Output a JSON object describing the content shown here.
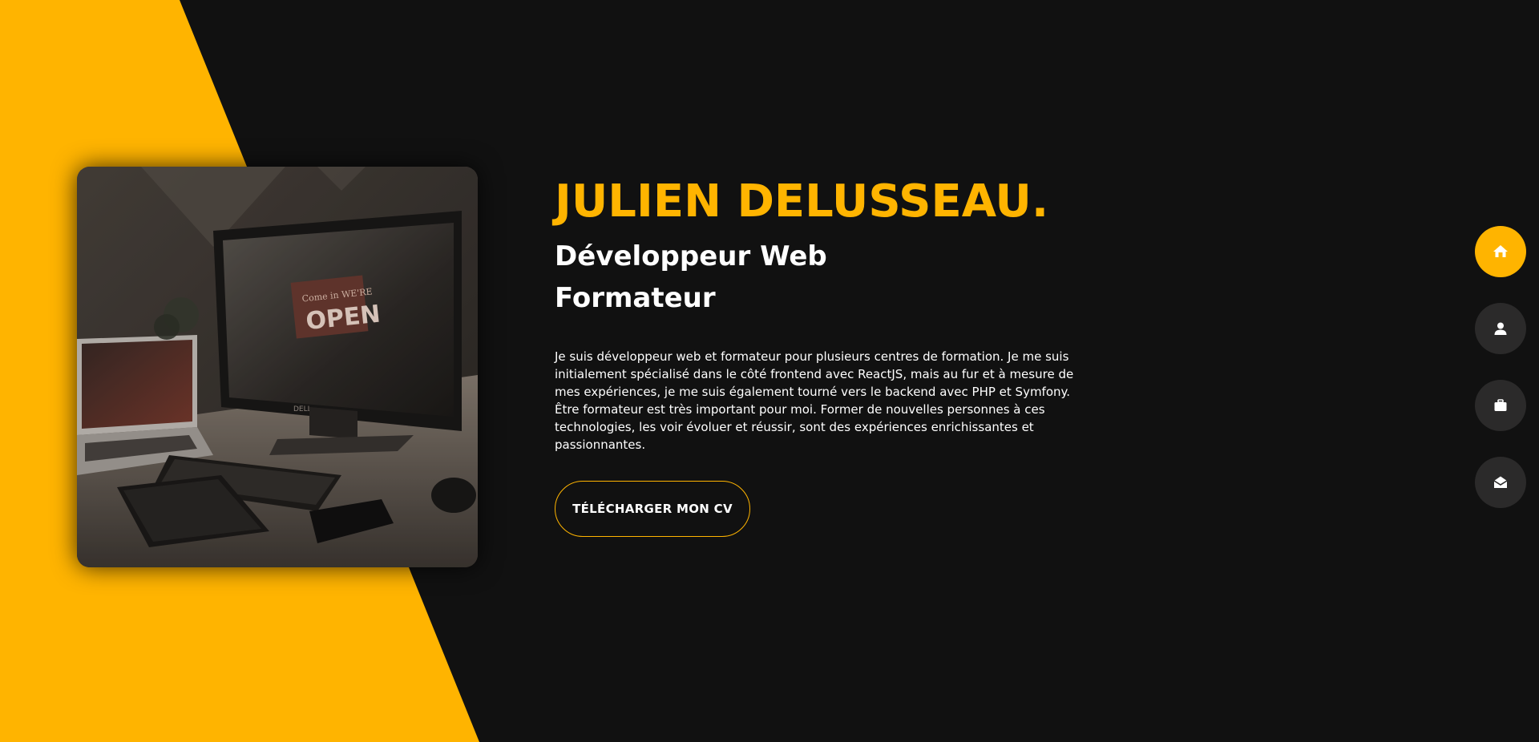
{
  "hero": {
    "name": "JULIEN DELUSSEAU.",
    "subtitle_line1": "Développeur Web",
    "subtitle_line2": "Formateur",
    "description": [
      "Je suis développeur web et formateur pour plusieurs centres de formation. Je me suis initialement spécialisé dans le côté frontend avec ReactJS, mais au fur et à mesure de mes expériences, je me suis également tourné vers le backend avec PHP et Symfony.",
      "Être formateur est très important pour moi. Former de nouvelles personnes à ces technologies, les voir évoluer et réussir, sont des expériences enrichissantes et passionnantes."
    ],
    "cv_button": "TÉLÉCHARGER MON CV"
  },
  "photo": {
    "sign_text": "OPEN",
    "sign_top": "Come in WE'RE",
    "monitor_brand": "DELL"
  },
  "nav": {
    "items": [
      {
        "icon": "home-icon",
        "active": true
      },
      {
        "icon": "user-icon",
        "active": false
      },
      {
        "icon": "briefcase-icon",
        "active": false
      },
      {
        "icon": "envelope-open-icon",
        "active": false
      }
    ]
  },
  "colors": {
    "accent": "#ffb400",
    "background": "#111111",
    "nav_inactive": "#2b2a2a",
    "text": "#ffffff"
  }
}
